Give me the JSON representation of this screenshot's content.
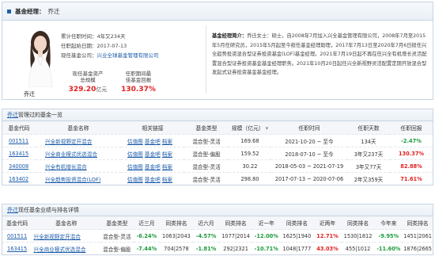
{
  "header": {
    "label": "基金经理：",
    "name": "乔迁"
  },
  "profile": {
    "name": "乔迁",
    "tenure_label": "累计任职时间：",
    "tenure_value": "4年又234天",
    "start_label": "任职起始日期：",
    "start_value": "2017-07-13",
    "company_label": "现任基金公司：",
    "company_value": "兴业全球基金管理有限公司",
    "asset_label_1": "现任基金资产",
    "asset_label_2": "总规模",
    "asset_value": "329.20",
    "asset_unit": "亿元",
    "return_label_1": "任职期间最",
    "return_label_2": "佳基金回报",
    "return_value": "130.37%"
  },
  "bio": {
    "label": "基金经理简介：",
    "text": "乔迁女士：硕士，自2008年7月加入兴全基金管理有限公司，2008年7月至2015年5月任研究员，2015年5月起至今担任基金经理助理，2017年7月13日至2020年7月6日担任兴全趋势投资混合型证券投资基金(LOF)基金经理。2021年7月19日起不再在任兴全有机增长灵活配置混合型证券投资基金基金经理职务。2021年10月20日起任兴全新视野灵活配置定期开放混合型发起式证券投资基金基金经理。"
  },
  "current": {
    "label_link": "乔迁",
    "label_rest": "管理过的基金一览",
    "headers": [
      "基金代码",
      "基金名称",
      "相关链接",
      "基金类型",
      "规模（亿元）",
      "任职时间",
      "任职天数",
      "任职回报"
    ],
    "links": [
      "估值图",
      "基金吧",
      "档案"
    ],
    "rows": [
      {
        "code": "001511",
        "name": "兴全新视野定开混合",
        "type": "混合型-灵活",
        "size": "169.68",
        "period": "2021-10-20 ~ 至今",
        "days": "134天",
        "ret": "-2.47%",
        "sign": "neg"
      },
      {
        "code": "163415",
        "name": "兴全商业模式优选混合",
        "type": "混合型-偏股",
        "size": "159.52",
        "period": "2018-07-10 ~ 至今",
        "days": "3年又237天",
        "ret": "130.37%",
        "sign": "pos"
      },
      {
        "code": "340008",
        "name": "兴全有机增长混合",
        "type": "混合型-灵活",
        "size": "30.22",
        "period": "2018-05-03 ~ 2021-07-19",
        "days": "3年又77天",
        "ret": "82.88%",
        "sign": "pos"
      },
      {
        "code": "163402",
        "name": "兴全趋势投资混合(LOF)",
        "type": "混合型-灵活",
        "size": "298.80",
        "period": "2017-07-13 ~ 2020-07-06",
        "days": "2年又359天",
        "ret": "71.61%",
        "sign": "pos"
      }
    ]
  },
  "performance": {
    "label_link": "乔迁",
    "label_rest": "现任基金业绩与排名详情",
    "headers": [
      "基金代码",
      "基金名称",
      "基金类型",
      "近三月",
      "同类排名",
      "近六月",
      "同类排名",
      "近一年",
      "同类排名",
      "近两年",
      "同类排名",
      "今年来",
      "同类排名"
    ],
    "rows": [
      {
        "code": "001511",
        "name": "兴全新视野定开混合",
        "type": "混合型-灵活",
        "m3": "-6.24%",
        "m3s": "neg",
        "m3r": "1063|2043",
        "m6": "-4.57%",
        "m6s": "neg",
        "m6r": "1077|2014",
        "y1": "-12.00%",
        "y1s": "neg",
        "y1r": "1625|1940",
        "y2": "12.71%",
        "y2s": "pos",
        "y2r": "1530|1812",
        "ytd": "-9.95%",
        "ytds": "neg",
        "ytdr": "1451|2061"
      },
      {
        "code": "163415",
        "name": "兴全商业模式优选混合",
        "type": "混合型-偏股",
        "m3": "-7.44%",
        "m3s": "neg",
        "m3r": "704|2578",
        "m6": "-1.81%",
        "m6s": "neg",
        "m6r": "292|2321",
        "y1": "-10.71%",
        "y1s": "neg",
        "y1r": "1048|1777",
        "y2": "43.03%",
        "y2s": "pos",
        "y2r": "455|1012",
        "ytd": "-11.60%",
        "ytds": "neg",
        "ytdr": "1876|2665"
      }
    ]
  }
}
